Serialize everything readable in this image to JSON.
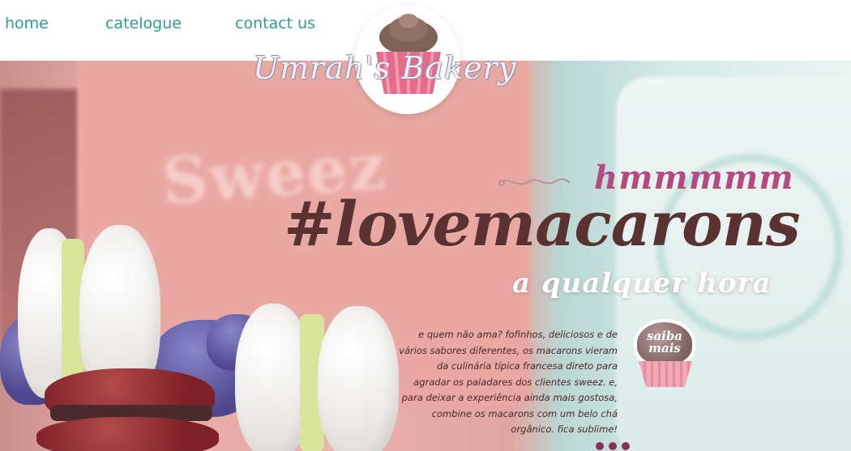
{
  "nav": {
    "home": "home",
    "catalogue": "catelogue",
    "contact": "contact us"
  },
  "logo": {
    "title": "Umrah's Bakery"
  },
  "hero": {
    "kicker": "hmmmmm",
    "headline": "#lovemacarons",
    "subheadline": "a qualquer hora",
    "description": "e quem não ama? fofinhos, deliciosos e de vários sabores diferentes, os macarons vieram da culinária típica francesa direto para agradar os paladares dos clientes sweez. e, para deixar a experiência ainda mais gostosa, combine os macarons com um belo chá orgânico. fica sublime!",
    "cta_label": "saiba mais"
  },
  "colors": {
    "nav": "#2f9a94",
    "headline": "#5a3232",
    "kicker": "#b54a83",
    "dots": "#8a2f55"
  },
  "icons": {
    "logo": "cupcake-icon",
    "ornament": "swirl-ornament-icon",
    "cta": "cupcake-icon"
  }
}
